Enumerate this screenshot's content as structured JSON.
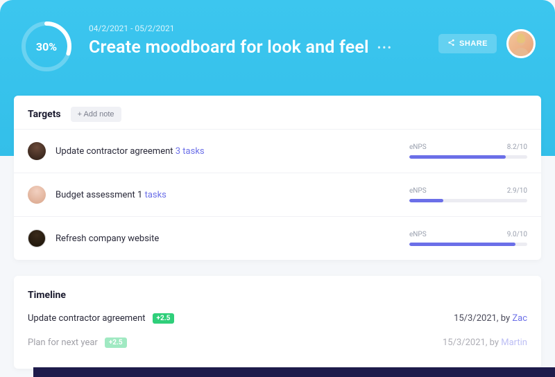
{
  "header": {
    "progress_pct": "30%",
    "progress_value": 30,
    "date_range": "04/2/2021 - 05/2/2021",
    "title": "Create moodboard for look and feel",
    "share_label": "SHARE"
  },
  "targets": {
    "title": "Targets",
    "add_note_label": "+ Add note",
    "metric_label": "eNPS",
    "items": [
      {
        "text": "Update contractor agreement ",
        "link_text": "3 tasks",
        "score": "8.2/10",
        "fill": 82
      },
      {
        "text": "Budget assessment 1 ",
        "link_text": "tasks",
        "score": "2.9/10",
        "fill": 29
      },
      {
        "text": "Refresh company website",
        "link_text": "",
        "score": "9.0/10",
        "fill": 90
      }
    ]
  },
  "timeline": {
    "title": "Timeline",
    "items": [
      {
        "text": "Update contractor agreement",
        "badge": "+2.5",
        "date": "15/3/2021, by ",
        "author": "Zac",
        "faded": false
      },
      {
        "text": "Plan for next year",
        "badge": "+2.5",
        "date": "15/3/2021, by ",
        "author": "Martin",
        "faded": true
      }
    ]
  }
}
